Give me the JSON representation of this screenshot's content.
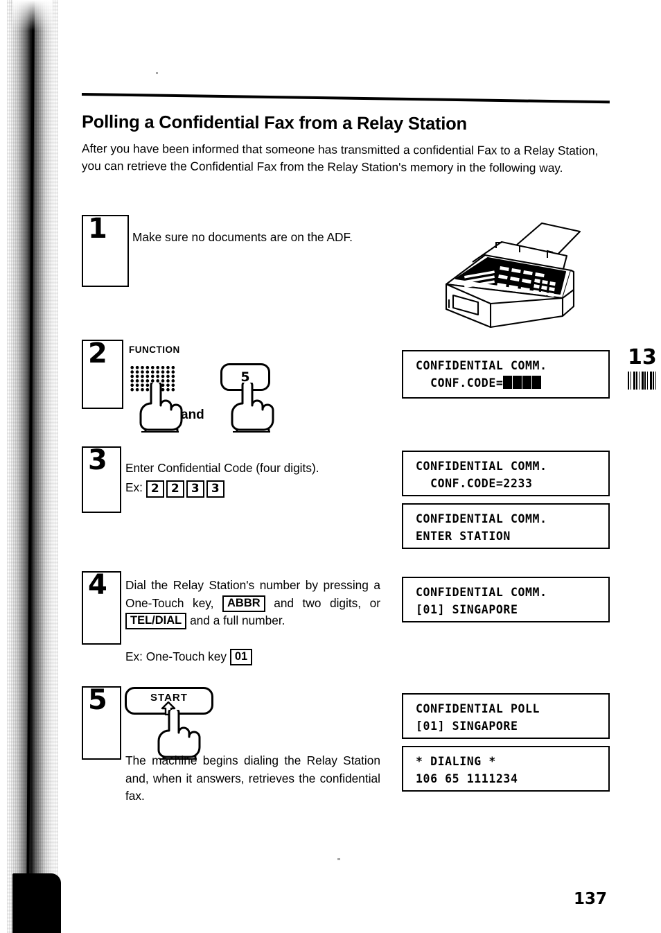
{
  "document": {
    "title": "Polling a Confidential Fax from a Relay Station",
    "intro": "After you have been informed that someone has transmitted a confidential Fax to a Relay Station, you can retrieve the Confidential Fax from the Relay Station's memory in the following way.",
    "page_number": "137",
    "chapter_marker": "13"
  },
  "steps": [
    {
      "number": "1",
      "text": "Make sure no documents are on the ADF.",
      "illustration": "fax-machine"
    },
    {
      "number": "2",
      "function_label": "FUNCTION",
      "conjunction": "and",
      "key_label": "5",
      "illustration": "function-keypad-and-key-5"
    },
    {
      "number": "3",
      "text": "Enter Confidential Code (four digits).",
      "example_prefix": "Ex:",
      "example_keys": [
        "2",
        "2",
        "3",
        "3"
      ]
    },
    {
      "number": "4",
      "text_part_1": "Dial the Relay Station's number by pressing a One-Touch key,",
      "key_abbr": "ABBR",
      "text_part_2": "and two digits, or",
      "key_teldial": "TEL/DIAL",
      "text_part_3": "and a full number.",
      "example_prefix": "Ex: One-Touch key",
      "example_key": "01"
    },
    {
      "number": "5",
      "button_label": "START",
      "text": "The machine begins dialing the Relay Station and, when it answers, retrieves the confidential fax."
    }
  ],
  "displays": [
    {
      "id": "display-step2",
      "line1": "CONFIDENTIAL COMM.",
      "line2_prefix": "  CONF.CODE=",
      "line2_blocks": 4
    },
    {
      "id": "display-step3-a",
      "line1": "CONFIDENTIAL COMM.",
      "line2": "  CONF.CODE=2233"
    },
    {
      "id": "display-step3-b",
      "line1": "CONFIDENTIAL COMM.",
      "line2": "ENTER STATION"
    },
    {
      "id": "display-step4",
      "line1": "CONFIDENTIAL COMM.",
      "line2": "[01] SINGAPORE"
    },
    {
      "id": "display-step5-a",
      "line1": "CONFIDENTIAL POLL",
      "line2": "[01] SINGAPORE"
    },
    {
      "id": "display-step5-b",
      "line1": "* DIALING *",
      "line2": "106 65 1111234"
    }
  ],
  "colors": {
    "ink": "#000000",
    "paper": "#ffffff"
  }
}
